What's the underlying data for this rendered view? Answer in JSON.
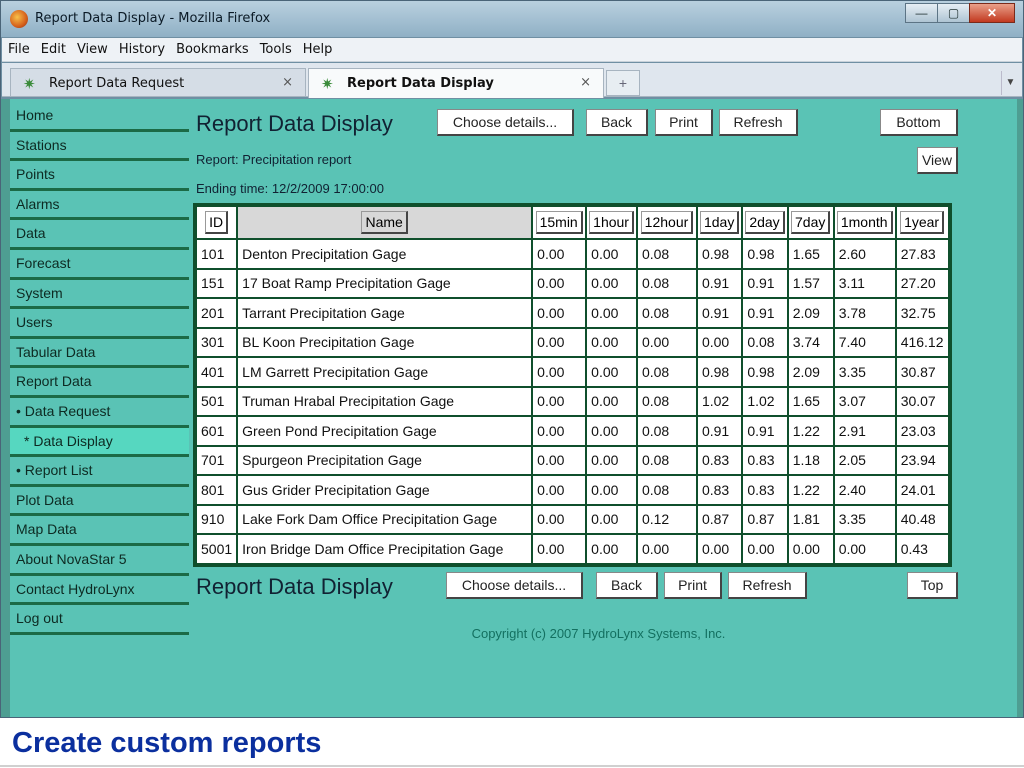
{
  "window": {
    "title": "Report Data Display - Mozilla Firefox",
    "min": "—",
    "max": "▢",
    "close": "✕"
  },
  "menu": [
    "File",
    "Edit",
    "View",
    "History",
    "Bookmarks",
    "Tools",
    "Help"
  ],
  "tabs": [
    {
      "label": "Report Data Request"
    },
    {
      "label": "Report Data Display"
    }
  ],
  "tab_close": "×",
  "new_tab": "+",
  "sidebar": [
    "Home",
    "Stations",
    "Points",
    "Alarms",
    "Data",
    "Forecast",
    "System",
    "Users",
    "Tabular Data",
    "Report Data",
    "• Data Request",
    "* Data Display",
    "• Report List",
    "Plot Data",
    "Map Data",
    "About NovaStar 5",
    "Contact HydroLynx",
    "Log out"
  ],
  "header": {
    "title": "Report Data Display",
    "choose": "Choose details...",
    "back": "Back",
    "print": "Print",
    "refresh": "Refresh",
    "bottom": "Bottom",
    "view": "View",
    "top": "Top"
  },
  "report": {
    "name": "Report: Precipitation report",
    "ending": "Ending time: 12/2/2009 17:00:00"
  },
  "table": {
    "columns": [
      "ID",
      "Name",
      "15min",
      "1hour",
      "12hour",
      "1day",
      "2day",
      "7day",
      "1month",
      "1year"
    ],
    "rows": [
      [
        "101",
        "Denton Precipitation Gage",
        "0.00",
        "0.00",
        "0.08",
        "0.98",
        "0.98",
        "1.65",
        "2.60",
        "27.83"
      ],
      [
        "151",
        "17 Boat Ramp Precipitation Gage",
        "0.00",
        "0.00",
        "0.08",
        "0.91",
        "0.91",
        "1.57",
        "3.11",
        "27.20"
      ],
      [
        "201",
        "Tarrant Precipitation Gage",
        "0.00",
        "0.00",
        "0.08",
        "0.91",
        "0.91",
        "2.09",
        "3.78",
        "32.75"
      ],
      [
        "301",
        "BL Koon Precipitation Gage",
        "0.00",
        "0.00",
        "0.00",
        "0.00",
        "0.08",
        "3.74",
        "7.40",
        "416.12"
      ],
      [
        "401",
        "LM Garrett Precipitation Gage",
        "0.00",
        "0.00",
        "0.08",
        "0.98",
        "0.98",
        "2.09",
        "3.35",
        "30.87"
      ],
      [
        "501",
        "Truman Hrabal Precipitation Gage",
        "0.00",
        "0.00",
        "0.08",
        "1.02",
        "1.02",
        "1.65",
        "3.07",
        "30.07"
      ],
      [
        "601",
        "Green Pond Precipitation Gage",
        "0.00",
        "0.00",
        "0.08",
        "0.91",
        "0.91",
        "1.22",
        "2.91",
        "23.03"
      ],
      [
        "701",
        "Spurgeon Precipitation Gage",
        "0.00",
        "0.00",
        "0.08",
        "0.83",
        "0.83",
        "1.18",
        "2.05",
        "23.94"
      ],
      [
        "801",
        "Gus Grider Precipitation Gage",
        "0.00",
        "0.00",
        "0.08",
        "0.83",
        "0.83",
        "1.22",
        "2.40",
        "24.01"
      ],
      [
        "910",
        "Lake Fork Dam Office Precipitation Gage",
        "0.00",
        "0.00",
        "0.12",
        "0.87",
        "0.87",
        "1.81",
        "3.35",
        "40.48"
      ],
      [
        "5001",
        "Iron Bridge Dam Office Precipitation Gage",
        "0.00",
        "0.00",
        "0.00",
        "0.00",
        "0.00",
        "0.00",
        "0.00",
        "0.43"
      ]
    ]
  },
  "copyright": "Copyright (c) 2007 HydroLynx Systems, Inc.",
  "caption": "Create custom reports",
  "colors": {
    "page_bg": "#5ac3b5",
    "nav_border": "#1b6a46",
    "table_border": "#0f4f2c",
    "caption": "#0b2f9e"
  }
}
